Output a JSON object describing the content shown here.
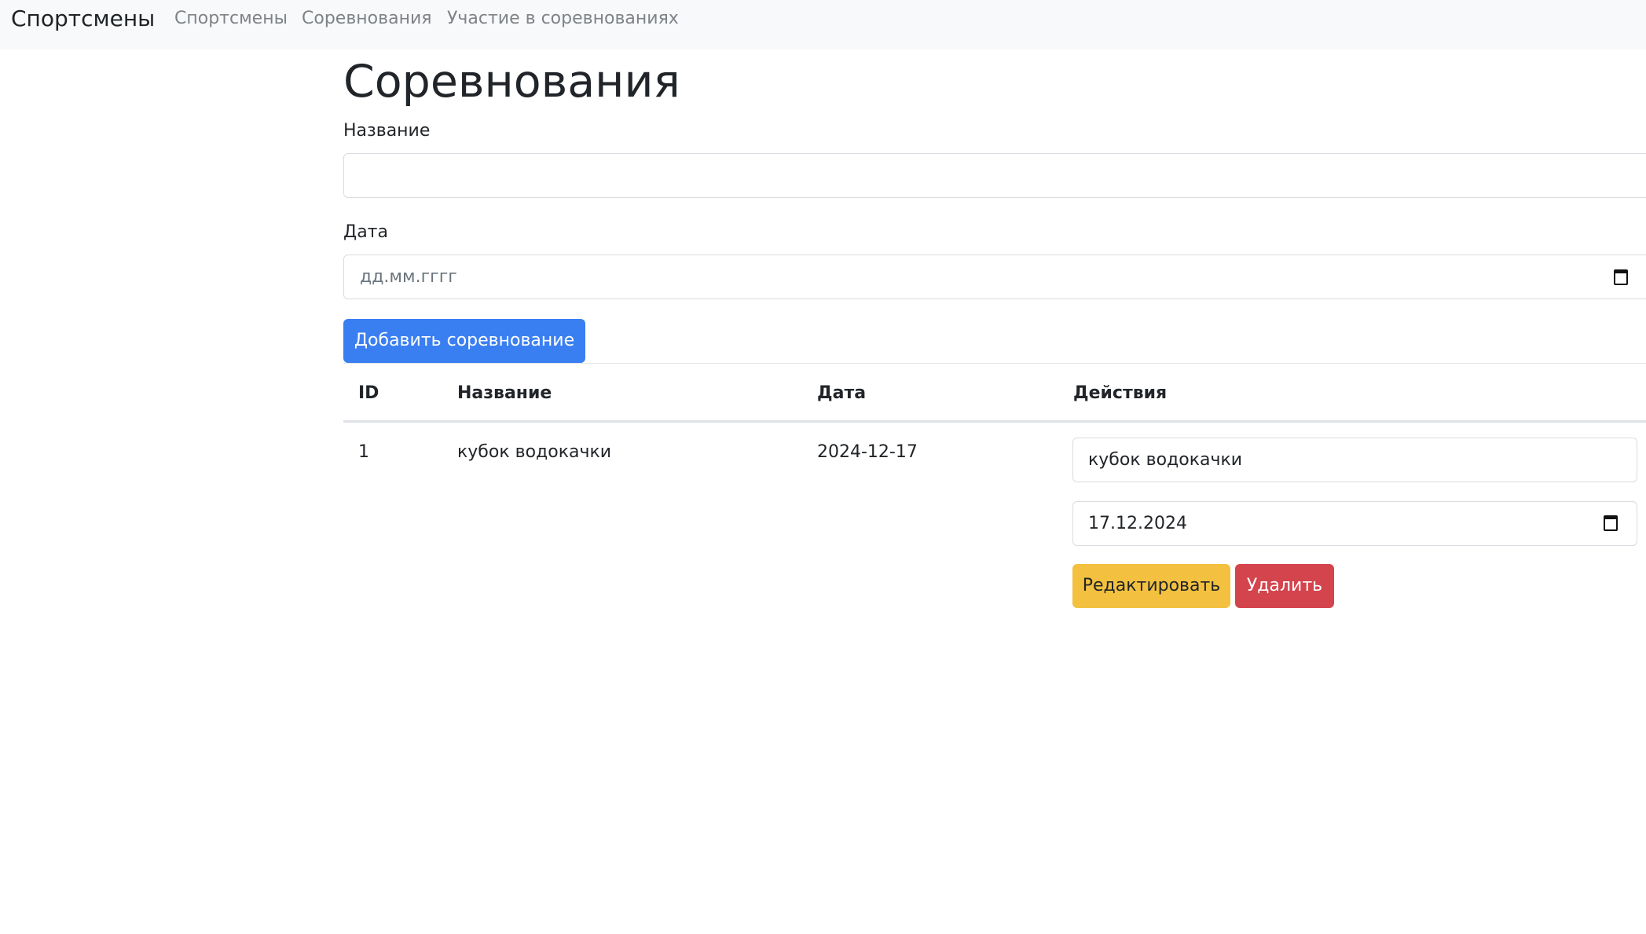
{
  "navbar": {
    "brand": "Спортсмены",
    "links": [
      "Спортсмены",
      "Соревнования",
      "Участие в соревнованиях"
    ]
  },
  "page": {
    "title": "Соревнования"
  },
  "form": {
    "name_label": "Название",
    "name_value": "",
    "date_label": "Дата",
    "date_placeholder": "дд.мм.гггг",
    "add_button": "Добавить соревнование"
  },
  "table": {
    "headers": [
      "ID",
      "Название",
      "Дата",
      "Действия"
    ],
    "rows": [
      {
        "id": "1",
        "name": "кубок водокачки",
        "date": "2024-12-17",
        "edit_name_value": "кубок водокачки",
        "edit_date_value": "17.12.2024",
        "edit_button": "Редактировать",
        "delete_button": "Удалить"
      }
    ]
  },
  "colors": {
    "navbar_bg": "#f8f9fa",
    "primary": "#3a7ff2",
    "warning": "#f3c13f",
    "danger": "#d4444d"
  },
  "icons": {
    "date_picker": "calendar-icon"
  }
}
